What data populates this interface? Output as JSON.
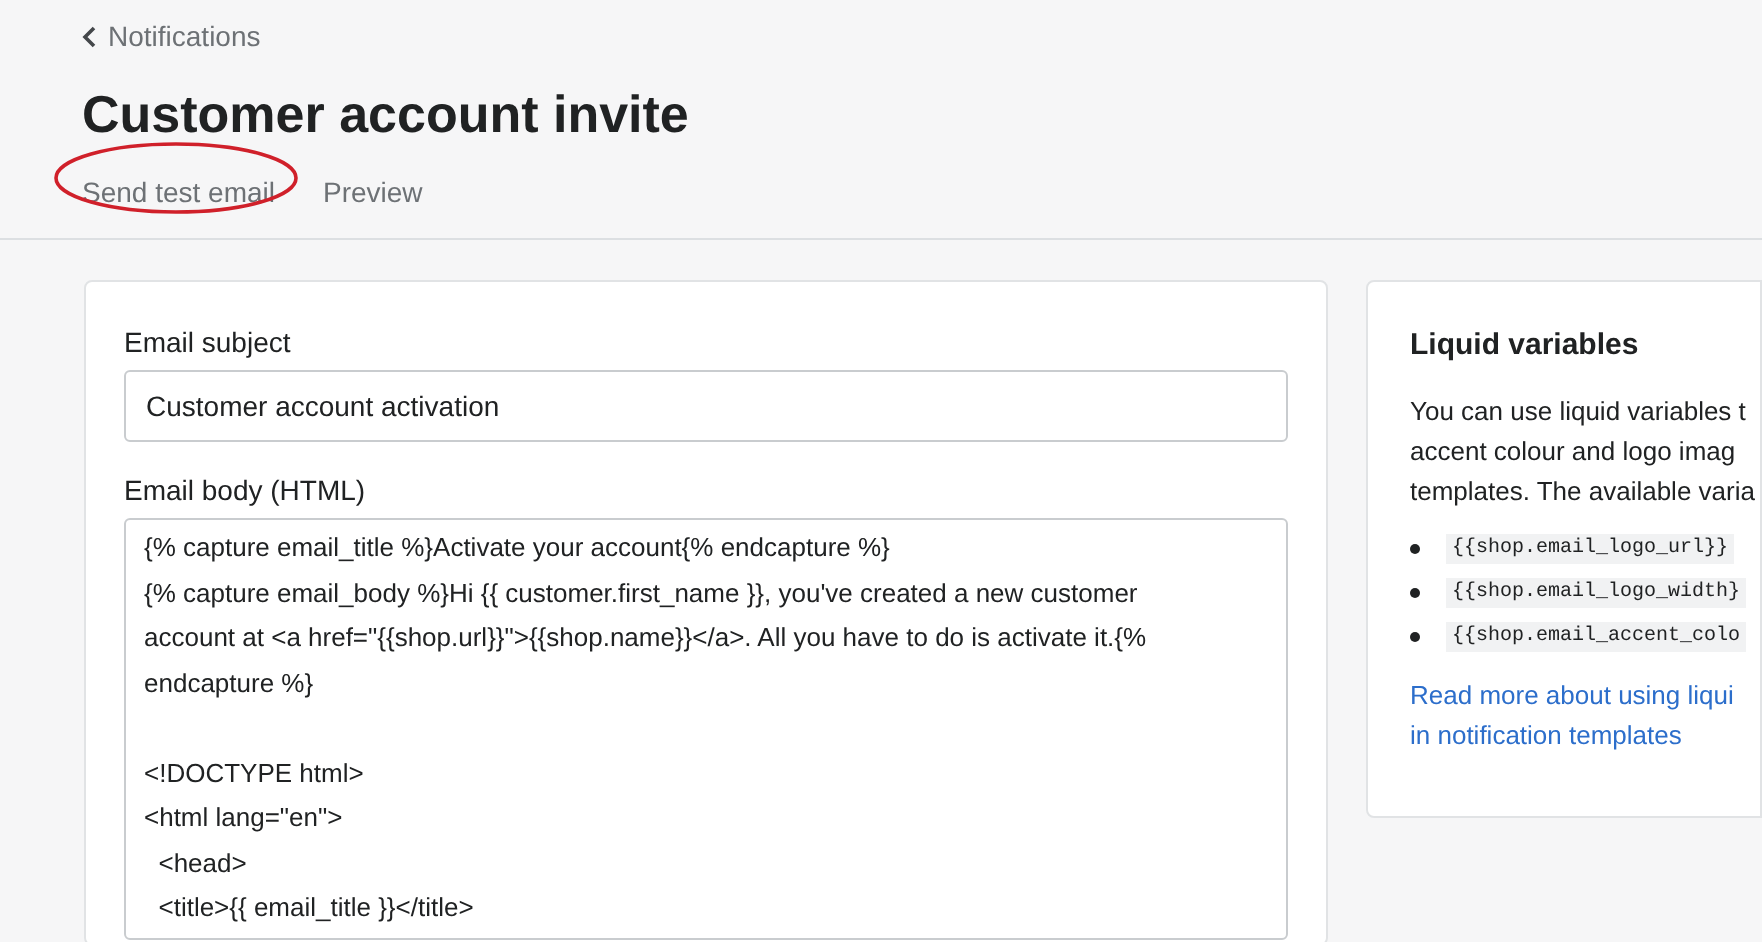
{
  "back_link": "Notifications",
  "title": "Customer account invite",
  "actions": [
    {
      "label": "Send test email",
      "circled": true
    },
    {
      "label": "Preview",
      "circled": false
    }
  ],
  "email_subject": {
    "label": "Email subject",
    "value": "Customer account activation"
  },
  "email_body": {
    "label": "Email body (HTML)",
    "value": "{% capture email_title %}Activate your account{% endcapture %}\n{% capture email_body %}Hi {{ customer.first_name }}, you've created a new customer account at <a href=\"{{shop.url}}\">{{shop.name}}</a>. All you have to do is activate it.{% endcapture %}\n\n<!DOCTYPE html>\n<html lang=\"en\">\n  <head>\n  <title>{{ email_title }}</title>"
  },
  "liquid_card": {
    "title": "Liquid variables",
    "text_lines": [
      "You can use liquid variables t",
      "accent colour and logo imag",
      "templates. The available varia"
    ],
    "variables": [
      "{{shop.email_logo_url}}",
      "{{shop.email_logo_width}",
      "{{shop.email_accent_colo"
    ],
    "link_lines": [
      "Read more about using liqui",
      "in notification templates"
    ]
  }
}
